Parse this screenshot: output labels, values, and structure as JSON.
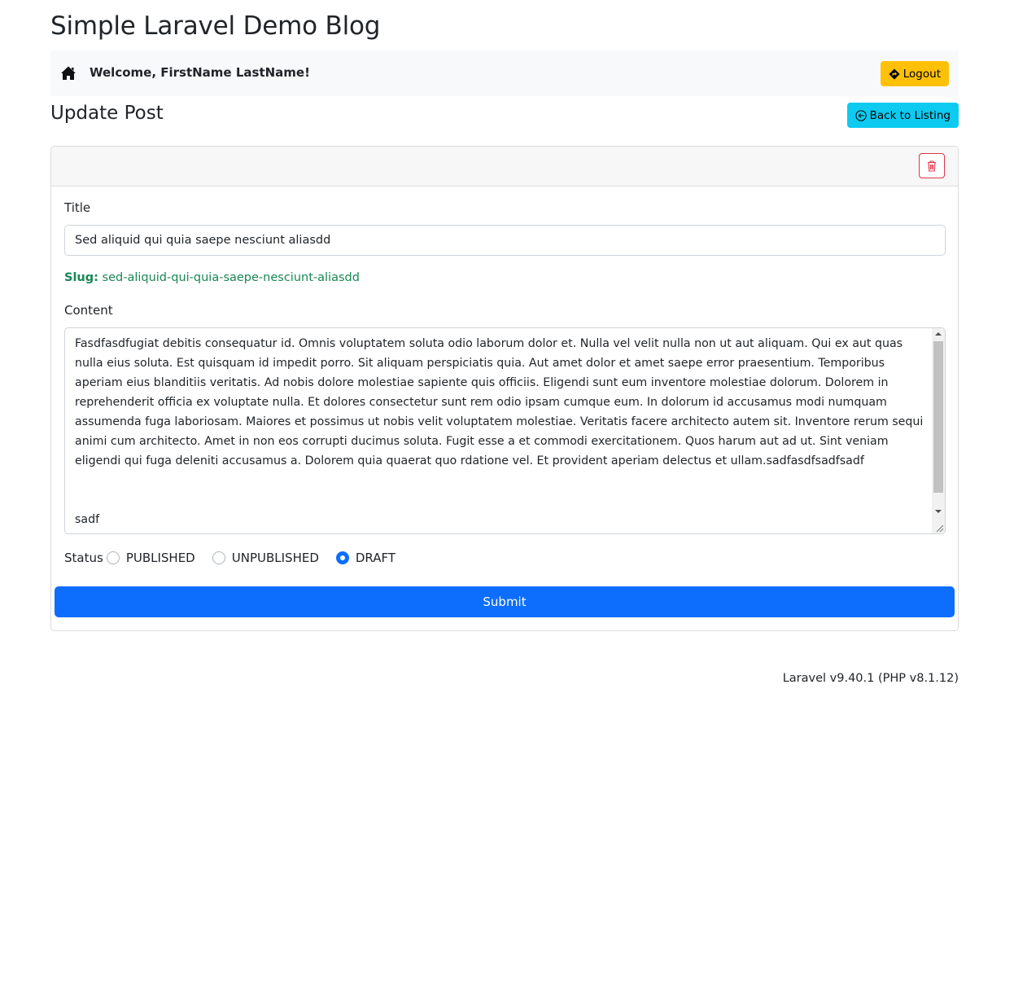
{
  "app": {
    "title": "Simple Laravel Demo Blog"
  },
  "navbar": {
    "home_icon": "home-icon",
    "welcome": "Welcome, FirstName LastName!",
    "logout_label": "Logout",
    "logout_icon": "diamond-arrow-icon",
    "logout_color": "#ffc107"
  },
  "page": {
    "heading": "Update Post",
    "back_label": "Back to Listing",
    "back_icon": "circle-arrow-left-icon",
    "back_color": "#0dcaf0"
  },
  "card": {
    "delete_icon": "trash-icon",
    "title_label": "Title",
    "title_value": "Sed aliquid qui quia saepe nesciunt aliasdd",
    "slug_label": "Slug:",
    "slug_value": "sed-aliquid-qui-quia-saepe-nesciunt-aliasdd",
    "content_label": "Content",
    "content_value": "Fasdfasdfugiat debitis consequatur id. Omnis voluptatem soluta odio laborum dolor et. Nulla vel velit nulla non ut aut aliquam. Qui ex aut quas nulla eius soluta. Est quisquam id impedit porro. Sit aliquam perspiciatis quia. Aut amet dolor et amet saepe error praesentium. Temporibus aperiam eius blanditiis veritatis. Ad nobis dolore molestiae sapiente quis officiis. Eligendi sunt eum inventore molestiae dolorum. Dolorem in reprehenderit officia ex voluptate nulla. Et dolores consectetur sunt rem odio ipsam cumque eum. In dolorum id accusamus modi numquam assumenda fuga laboriosam. Maiores et possimus ut nobis velit voluptatem molestiae. Veritatis facere architecto autem sit. Inventore rerum sequi animi cum architecto. Amet in non eos corrupti ducimus soluta. Fugit esse a et commodi exercitationem. Quos harum aut ad ut. Sint veniam eligendi qui fuga deleniti accusamus a. Dolorem quia quaerat quo rdatione vel. Et provident aperiam delectus et ullam.sadfasdfsadfsadf\n\n\nsadf",
    "status_label": "Status",
    "status_options": [
      "PUBLISHED",
      "UNPUBLISHED",
      "DRAFT"
    ],
    "status_selected": "DRAFT",
    "submit_label": "Submit",
    "submit_color": "#0d6efd"
  },
  "footer": {
    "version": "Laravel v9.40.1 (PHP v8.1.12)"
  }
}
